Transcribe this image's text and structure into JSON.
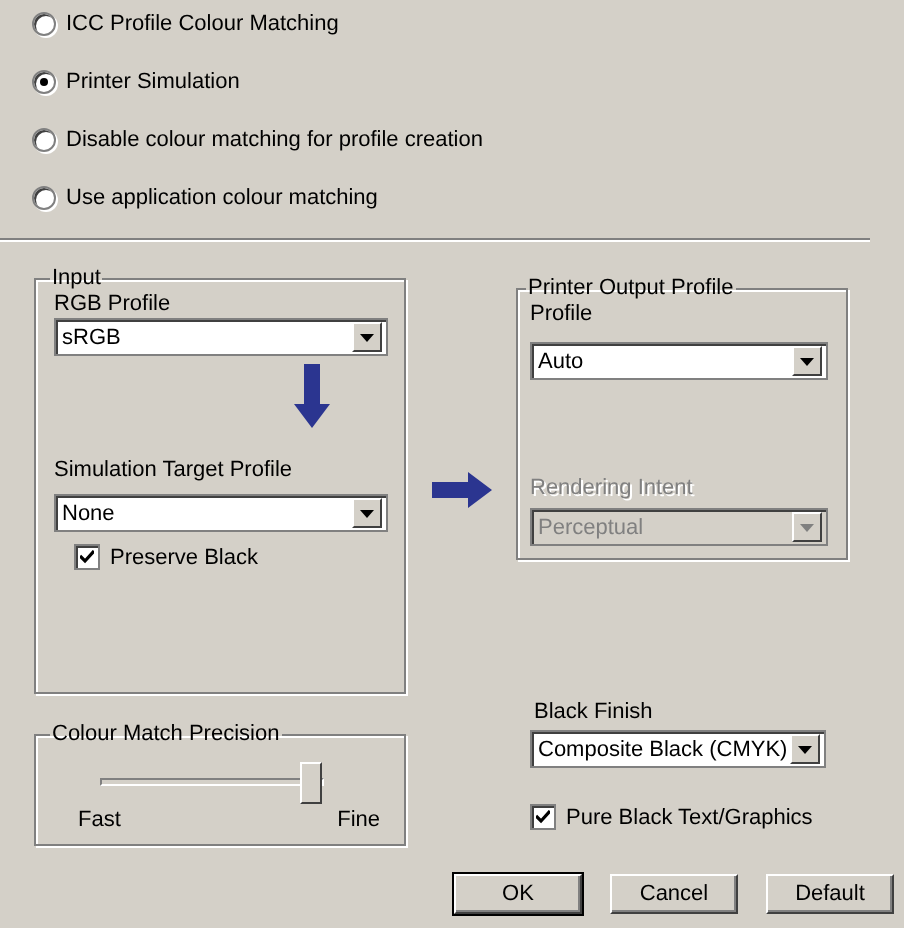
{
  "modes": [
    {
      "label": "ICC Profile Colour Matching",
      "selected": false
    },
    {
      "label": "Printer Simulation",
      "selected": true
    },
    {
      "label": "Disable colour matching for profile creation",
      "selected": false
    },
    {
      "label": "Use application colour matching",
      "selected": false
    }
  ],
  "input_group": {
    "title": "Input",
    "rgb_profile": {
      "label": "RGB Profile",
      "value": "sRGB",
      "disabled": false
    },
    "simulation_target": {
      "label": "Simulation Target Profile",
      "value": "None",
      "disabled": false
    },
    "preserve_black": {
      "label": "Preserve Black",
      "checked": true
    }
  },
  "output_group": {
    "title": "Printer Output Profile",
    "profile": {
      "label": "Profile",
      "value": "Auto",
      "disabled": false
    },
    "rendering_intent": {
      "label": "Rendering Intent",
      "value": "Perceptual",
      "disabled": true
    }
  },
  "precision": {
    "title": "Colour Match Precision",
    "level": 1,
    "min_label": "Fast",
    "max_label": "Fine"
  },
  "black_finish": {
    "label": "Black Finish",
    "value": "Composite Black (CMYK)",
    "disabled": false
  },
  "pure_black": {
    "label": "Pure Black Text/Graphics",
    "checked": true
  },
  "buttons": [
    {
      "label": "OK",
      "default": true
    },
    {
      "label": "Cancel",
      "default": false
    },
    {
      "label": "Default",
      "default": false
    }
  ]
}
